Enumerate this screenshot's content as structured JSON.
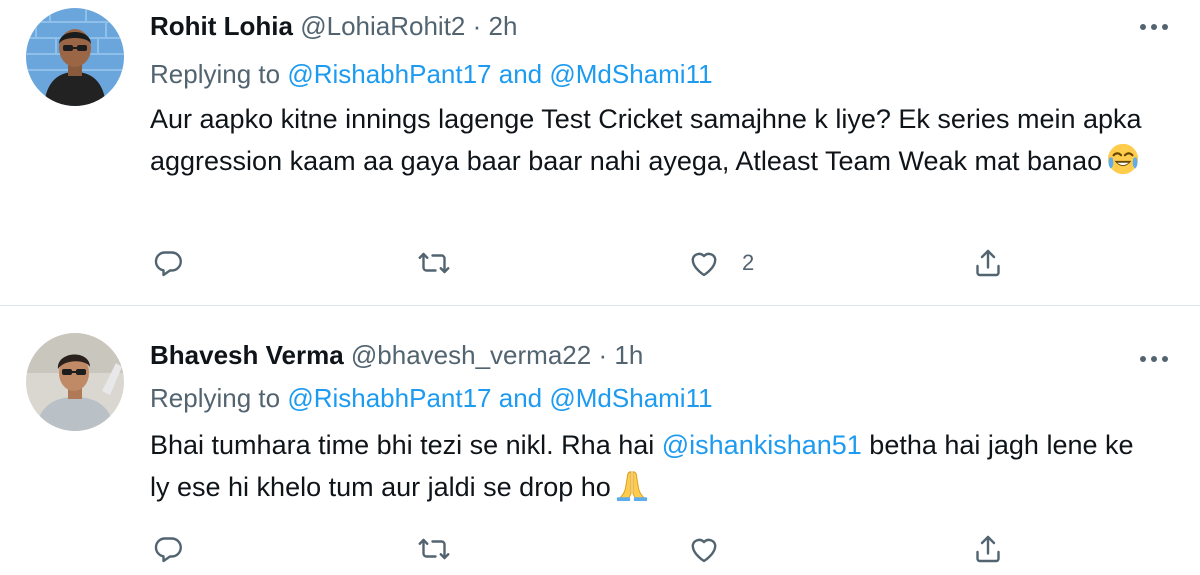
{
  "colors": {
    "link": "#1d9bf0",
    "text": "#0f1419",
    "secondary": "#536471",
    "divider": "#dfe4e8"
  },
  "tweets": [
    {
      "display_name": "Rohit Lohia",
      "handle": "@LohiaRohit2",
      "separator": "·",
      "time": "2h",
      "replying_prefix": "Replying to",
      "replying_to": [
        "@RishabhPant17",
        "@MdShami11"
      ],
      "replying_joiner": "and",
      "text_before_mention": "Aur aapko kitne innings lagenge Test Cricket samajhne k liye? Ek series mein apka aggression kaam aa gaya baar baar nahi ayega, Atleast Team Weak mat banao",
      "inline_mention": "",
      "text_after_mention": "",
      "emoji": "face-with-tears-of-joy",
      "actions": {
        "reply_icon": "reply-icon",
        "retweet_icon": "retweet-icon",
        "like_icon": "heart-icon",
        "share_icon": "share-icon",
        "like_count": "2"
      }
    },
    {
      "display_name": "Bhavesh Verma",
      "handle": "@bhavesh_verma22",
      "separator": "·",
      "time": "1h",
      "replying_prefix": "Replying to",
      "replying_to": [
        "@RishabhPant17",
        "@MdShami11"
      ],
      "replying_joiner": "and",
      "text_before_mention": "Bhai tumhara time bhi tezi se nikl. Rha hai ",
      "inline_mention": "@ishankishan51",
      "text_after_mention": " betha hai jagh lene ke ly ese hi khelo tum aur jaldi se drop ho",
      "emoji": "folded-hands",
      "actions": {
        "reply_icon": "reply-icon",
        "retweet_icon": "retweet-icon",
        "like_icon": "heart-icon",
        "share_icon": "share-icon",
        "like_count": ""
      }
    }
  ]
}
